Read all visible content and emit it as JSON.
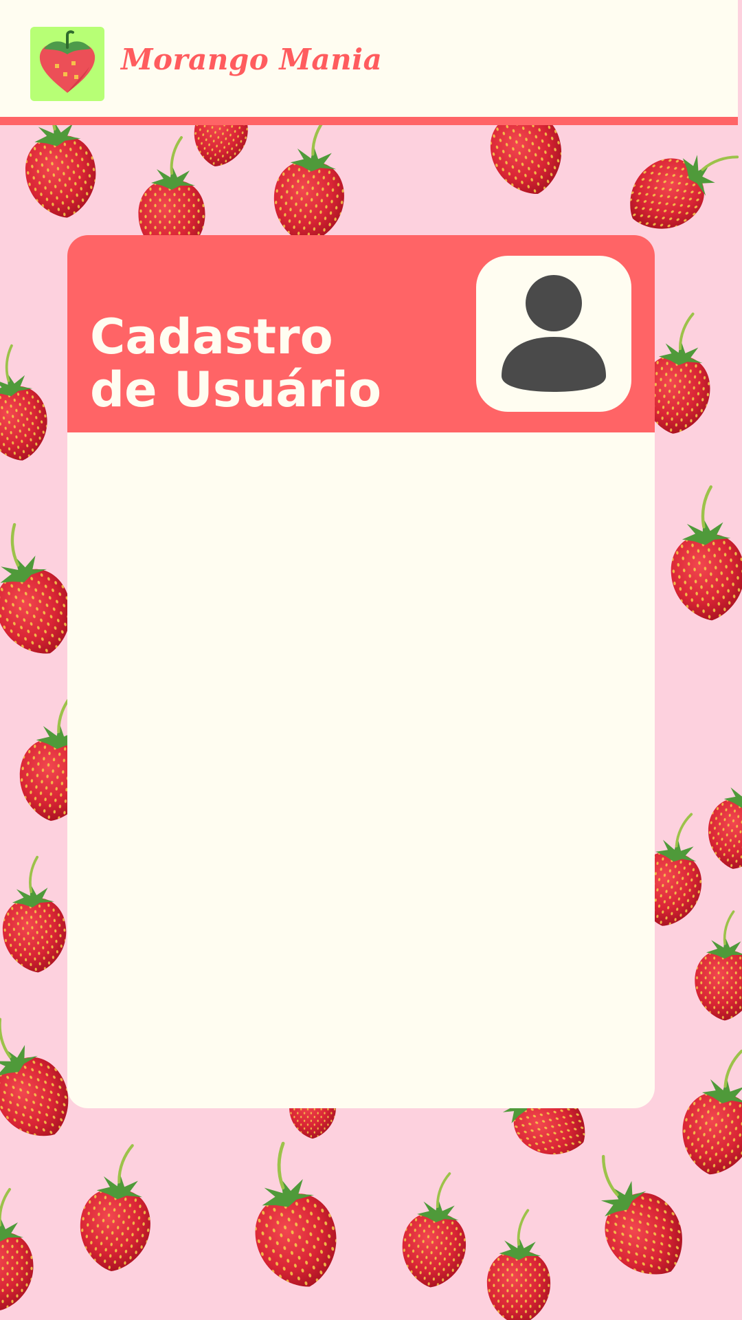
{
  "app": {
    "brand_name": "Morango Mania",
    "logo_icon": "strawberry-heart-icon"
  },
  "card": {
    "title_line1": "Cadastro",
    "title_line2": "de Usuário",
    "avatar_icon": "user-avatar-icon"
  },
  "colors": {
    "background": "#fdd1de",
    "surface": "#fffdf1",
    "accent": "#ff6466",
    "brand_text": "#ff5c5e",
    "logo_tile": "#b7ff75",
    "avatar_icon": "#4a4a4a",
    "strawberry": "#e0303f",
    "strawberry_leaf": "#4f9a3a"
  }
}
